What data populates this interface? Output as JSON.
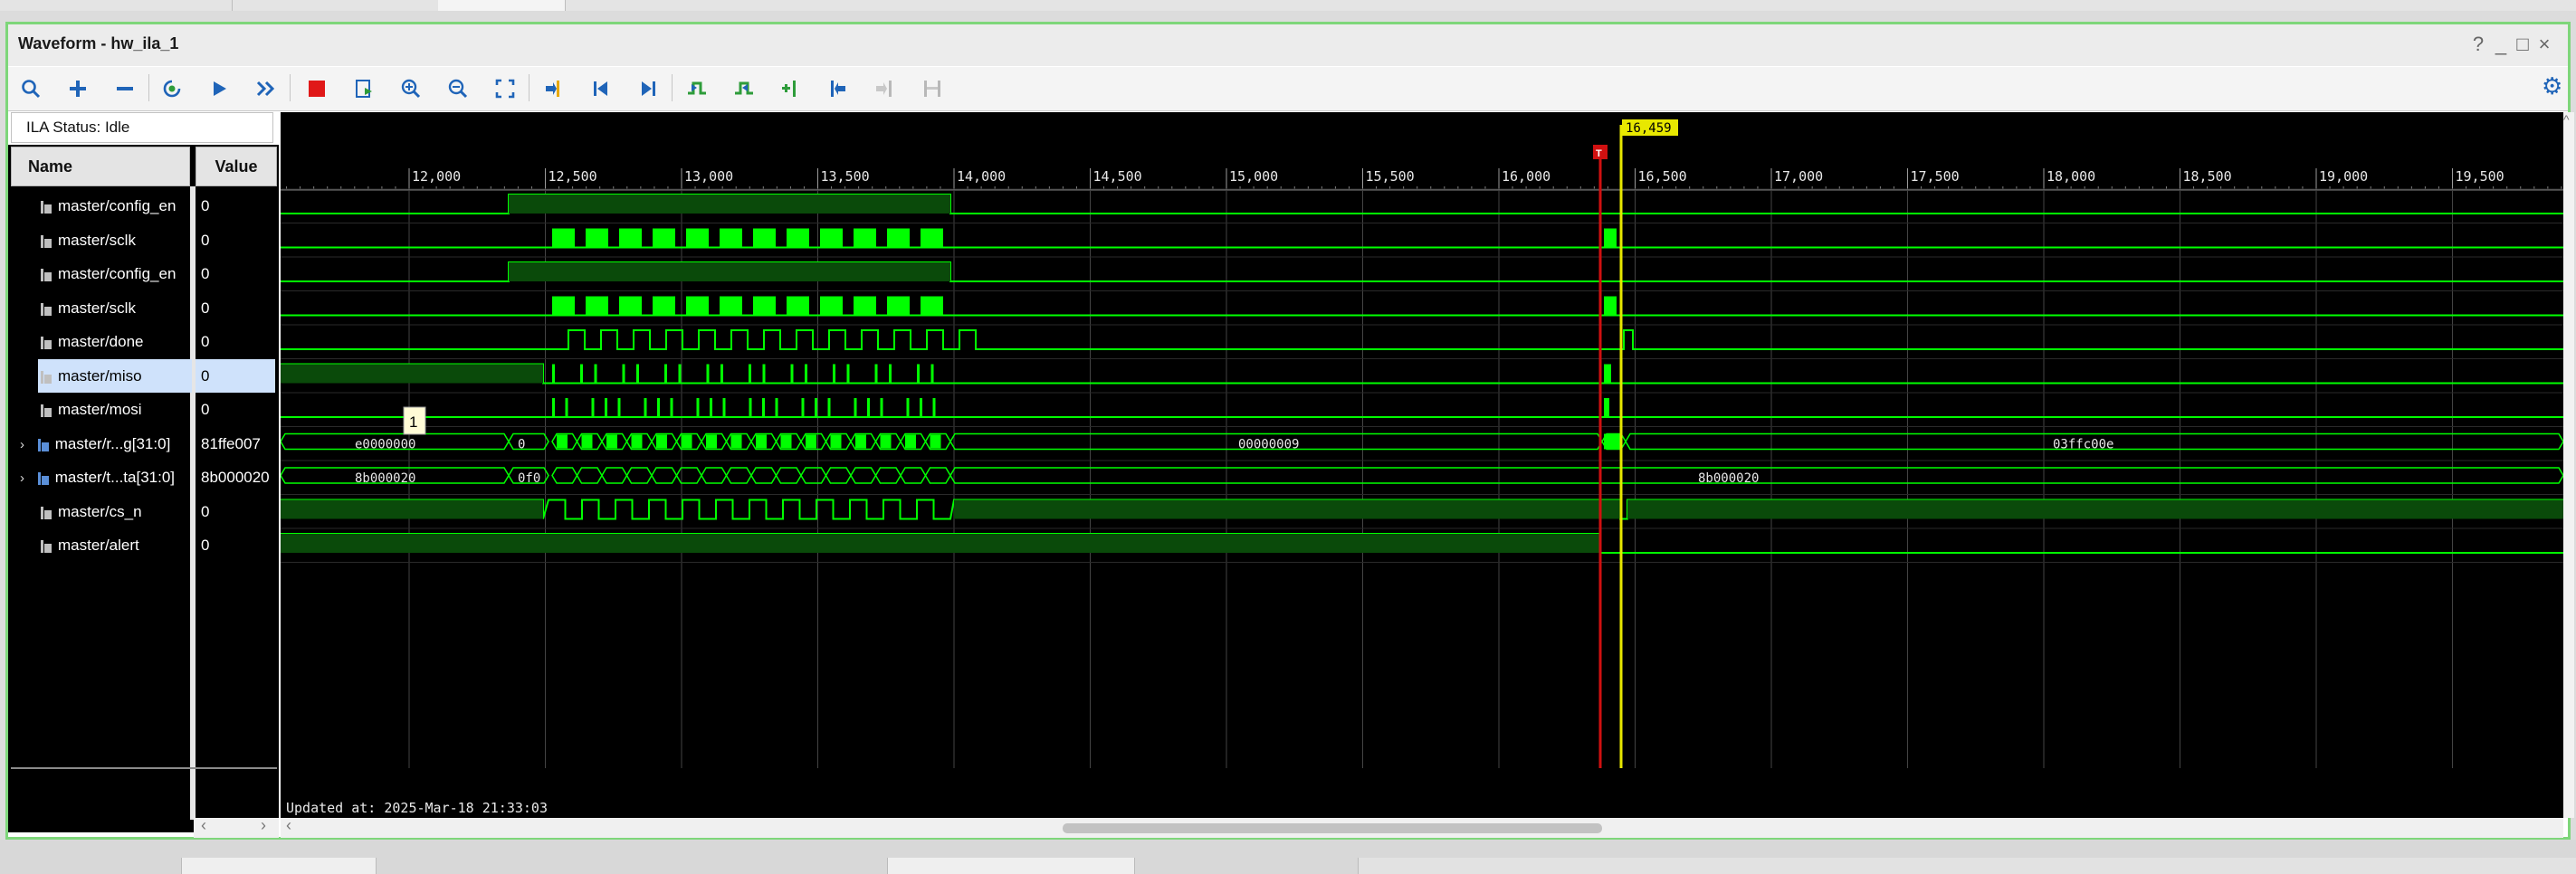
{
  "window": {
    "title": "Waveform - hw_ila_1",
    "controls": [
      "?",
      "_",
      "□",
      "×"
    ]
  },
  "toolbar": {
    "icons": [
      "search-icon",
      "zoom-plus-icon",
      "zoom-minus-icon",
      "refresh-icon",
      "run-icon",
      "run-all-icon",
      "stop-icon",
      "export-icon",
      "zoom-in-icon",
      "zoom-out-icon",
      "zoom-fit-icon",
      "go-to-cursor-icon",
      "go-to-start-icon",
      "go-to-end-icon",
      "previous-transition-icon",
      "next-transition-icon",
      "add-marker-icon",
      "previous-marker-icon",
      "next-marker-icon",
      "swap-cursor-icon"
    ]
  },
  "status": {
    "text": "ILA Status: Idle"
  },
  "columns": {
    "name": "Name",
    "value": "Value"
  },
  "signals": [
    {
      "name": "master/config_en",
      "value": "0",
      "type": "bit"
    },
    {
      "name": "master/sclk",
      "value": "0",
      "type": "bit"
    },
    {
      "name": "master/config_en",
      "value": "0",
      "type": "bit"
    },
    {
      "name": "master/sclk",
      "value": "0",
      "type": "bit"
    },
    {
      "name": "master/done",
      "value": "0",
      "type": "bit"
    },
    {
      "name": "master/miso",
      "value": "0",
      "type": "bit",
      "selected": true
    },
    {
      "name": "master/mosi",
      "value": "0",
      "type": "bit"
    },
    {
      "name": "master/r...g[31:0]",
      "value": "81ffe007",
      "type": "bus"
    },
    {
      "name": "master/t...ta[31:0]",
      "value": "8b000020",
      "type": "bus"
    },
    {
      "name": "master/cs_n",
      "value": "0",
      "type": "bit"
    },
    {
      "name": "master/alert",
      "value": "0",
      "type": "bit"
    }
  ],
  "timeline": {
    "ticks": [
      "12,000",
      "12,500",
      "13,000",
      "13,500",
      "14,000",
      "14,500",
      "15,000",
      "15,500",
      "16,000",
      "16,500",
      "17,000",
      "17,500",
      "18,000",
      "18,500",
      "19,000",
      "19,500"
    ],
    "cursor_value": "16,459",
    "trigger_marker": "T",
    "marker_label": "1"
  },
  "bus_labels": {
    "rdata": [
      "e0000000",
      "0",
      "00000009",
      "03ffc00e"
    ],
    "tdata": [
      "8b000020",
      "0f0",
      "8b000020"
    ]
  },
  "updated": "Updated at: 2025-Mar-18 21:33:03",
  "colors": {
    "wave": "#00ff00",
    "wave_fill": "#0a4a0a",
    "trigger": "#d01010",
    "cursor": "#e8e800",
    "grid": "#444444"
  }
}
